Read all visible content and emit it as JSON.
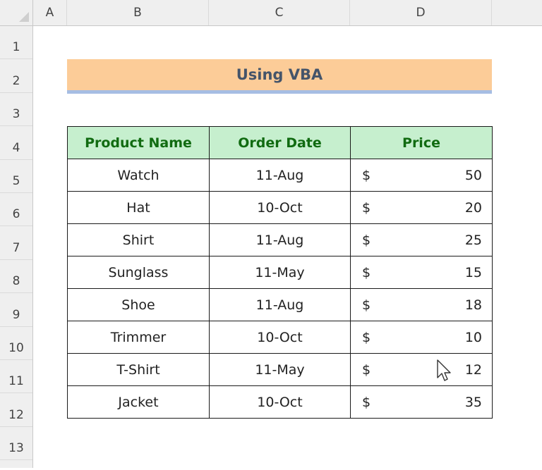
{
  "sheet": {
    "columns": [
      "A",
      "B",
      "C",
      "D"
    ],
    "rows": [
      "1",
      "2",
      "3",
      "4",
      "5",
      "6",
      "7",
      "8",
      "9",
      "10",
      "11",
      "12",
      "13"
    ]
  },
  "banner": {
    "title": "Using VBA"
  },
  "table": {
    "headers": [
      "Product Name",
      "Order Date",
      "Price"
    ],
    "rows": [
      {
        "product": "Watch",
        "date": "11-Aug",
        "currency": "$",
        "price": "50"
      },
      {
        "product": "Hat",
        "date": "10-Oct",
        "currency": "$",
        "price": "20"
      },
      {
        "product": "Shirt",
        "date": "11-Aug",
        "currency": "$",
        "price": "25"
      },
      {
        "product": "Sunglass",
        "date": "11-May",
        "currency": "$",
        "price": "15"
      },
      {
        "product": "Shoe",
        "date": "11-Aug",
        "currency": "$",
        "price": "18"
      },
      {
        "product": "Trimmer",
        "date": "10-Oct",
        "currency": "$",
        "price": "10"
      },
      {
        "product": "T-Shirt",
        "date": "11-May",
        "currency": "$",
        "price": "12"
      },
      {
        "product": "Jacket",
        "date": "10-Oct",
        "currency": "$",
        "price": "35"
      }
    ]
  },
  "colors": {
    "banner_bg": "#fccc98",
    "banner_underline": "#a6bde3",
    "header_bg": "#c6efce",
    "header_text": "#116b11"
  },
  "cursor": {
    "icon": "mouse-pointer-icon"
  }
}
